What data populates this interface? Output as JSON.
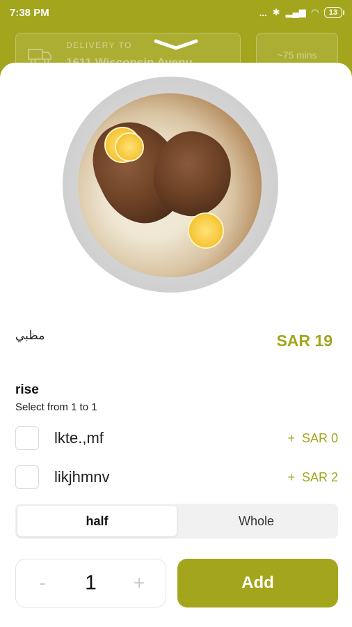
{
  "status_bar": {
    "time": "7:38 PM",
    "battery": "13",
    "signal_text": "..."
  },
  "header": {
    "delivery_label": "DELIVERY TO",
    "delivery_address": "1611 Wisconsin Avenu",
    "delivery_time": "~75 mins"
  },
  "dish": {
    "name": "مظبي",
    "price": "SAR 19",
    "image_icon": "dish-photo"
  },
  "options_group": {
    "title": "rise",
    "subtitle": "Select from 1 to 1",
    "items": [
      {
        "label": "lkte.,mf",
        "plus": "+",
        "price": "SAR 0"
      },
      {
        "label": "likjhmnv",
        "plus": "+",
        "price": "SAR 2"
      }
    ]
  },
  "size_toggle": {
    "options": [
      "half",
      "Whole"
    ],
    "selected": "half"
  },
  "quantity": {
    "minus": "-",
    "value": "1",
    "plus": "+"
  },
  "add_button": {
    "label": "Add"
  },
  "colors": {
    "accent": "#a3a51c"
  }
}
